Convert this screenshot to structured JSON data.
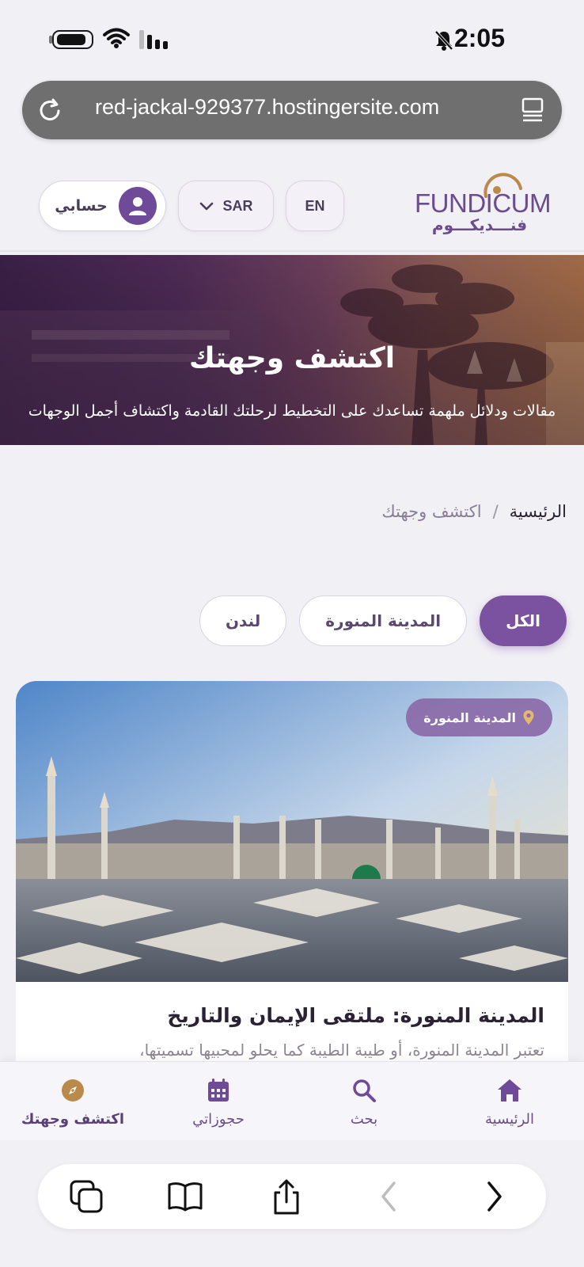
{
  "status_bar": {
    "time": "2:05"
  },
  "browser": {
    "url": "red-jackal-929377.hostingersite.com"
  },
  "header": {
    "logo_en": "FUNDICUM",
    "logo_ar": "فنـــديكـــوم",
    "language_button": "EN",
    "currency_button": "SAR",
    "account_button": "حسابي"
  },
  "hero": {
    "title": "اكتشف وجهتك",
    "subtitle": "مقالات ودلائل ملهمة تساعدك على التخطيط لرحلتك القادمة واكتشاف أجمل الوجهات"
  },
  "breadcrumb": {
    "home": "الرئيسية",
    "separator": "/",
    "current": "اكتشف وجهتك"
  },
  "filters": {
    "all": "الكل",
    "medina": "المدينة المنورة",
    "london": "لندن",
    "active": "الكل"
  },
  "card": {
    "location": "المدينة المنورة",
    "title": "المدينة المنورة: ملتقى الإيمان والتاريخ",
    "excerpt": "تعتبر المدينة المنورة، أو طيبة الطيبة كما يحلو لمحبيها تسميتها،"
  },
  "bottom_nav": {
    "home": "الرئيسية",
    "search": "بحث",
    "bookings": "حجوزاتي",
    "discover": "اكتشف وجهتك"
  },
  "colors": {
    "brand": "#7a52a0",
    "gold": "#b98a4a"
  }
}
